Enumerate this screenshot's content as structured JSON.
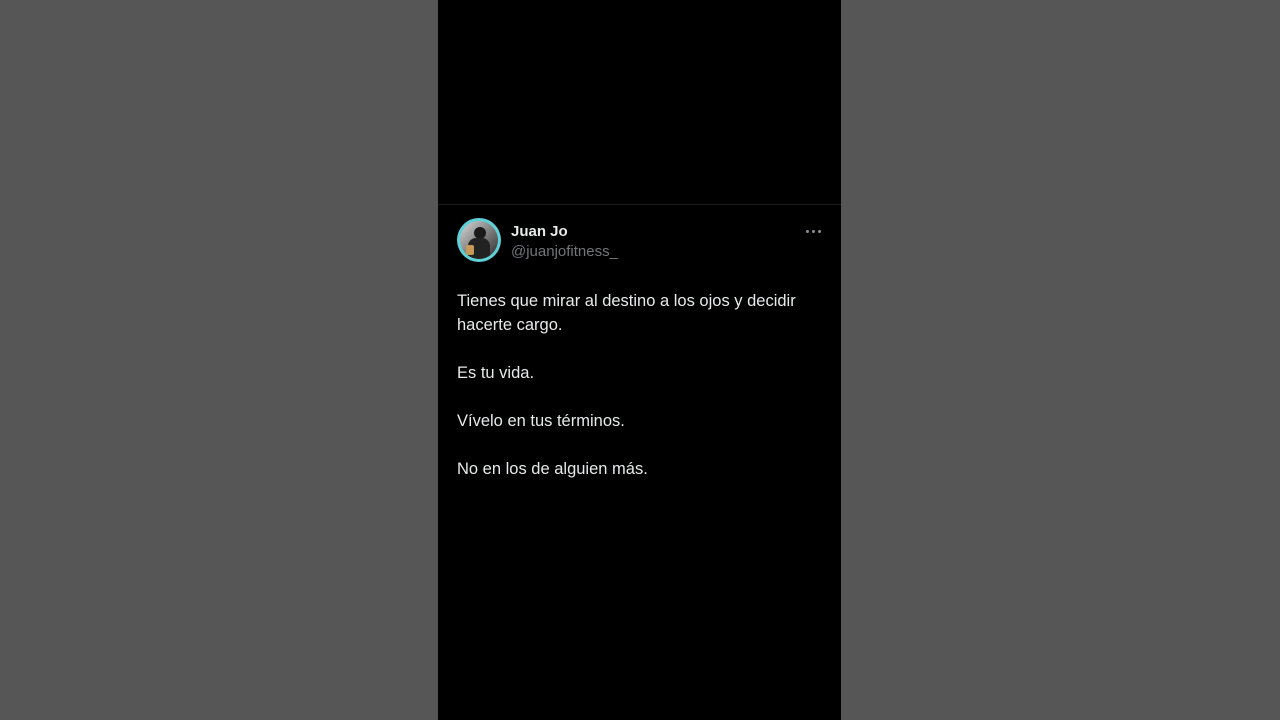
{
  "tweet": {
    "author_name": "Juan Jo",
    "author_handle": "@juanjofitness_",
    "more_icon": "more-horizontal-icon",
    "paragraphs": [
      "Tienes que mirar al destino a los ojos y decidir hacerte cargo.",
      "Es tu vida.",
      "Vívelo en tus términos.",
      "No en los de alguien más."
    ]
  },
  "colors": {
    "background_blur": "#575757",
    "card_background": "#000000",
    "primary_text": "#e7e9ea",
    "secondary_text": "#71767b",
    "avatar_ring": "#5fd0d6"
  }
}
